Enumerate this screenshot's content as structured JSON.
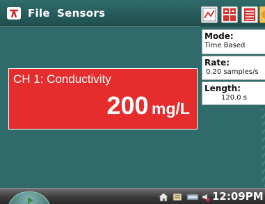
{
  "menu": {
    "file_label": "File",
    "sensors_label": "Sensors"
  },
  "toolbar": {
    "buttons": [
      {
        "name": "graph-view-icon"
      },
      {
        "name": "meter-view-icon"
      },
      {
        "name": "table-view-icon"
      },
      {
        "name": "more-icon"
      }
    ]
  },
  "meter": {
    "channel_label": "CH 1: Conductivity",
    "value": "200",
    "unit": "mg/L",
    "color": "#e52d2d"
  },
  "info": {
    "mode_label": "Mode:",
    "mode_value": "Time Based",
    "rate_label": "Rate:",
    "rate_value": "0.20 samples/s",
    "length_label": "Length:",
    "length_value": "120.0 s"
  },
  "taskbar": {
    "clock": "12:09PM"
  },
  "colors": {
    "accent": "#2f6b6b",
    "meter_background": "#e52d2d"
  }
}
